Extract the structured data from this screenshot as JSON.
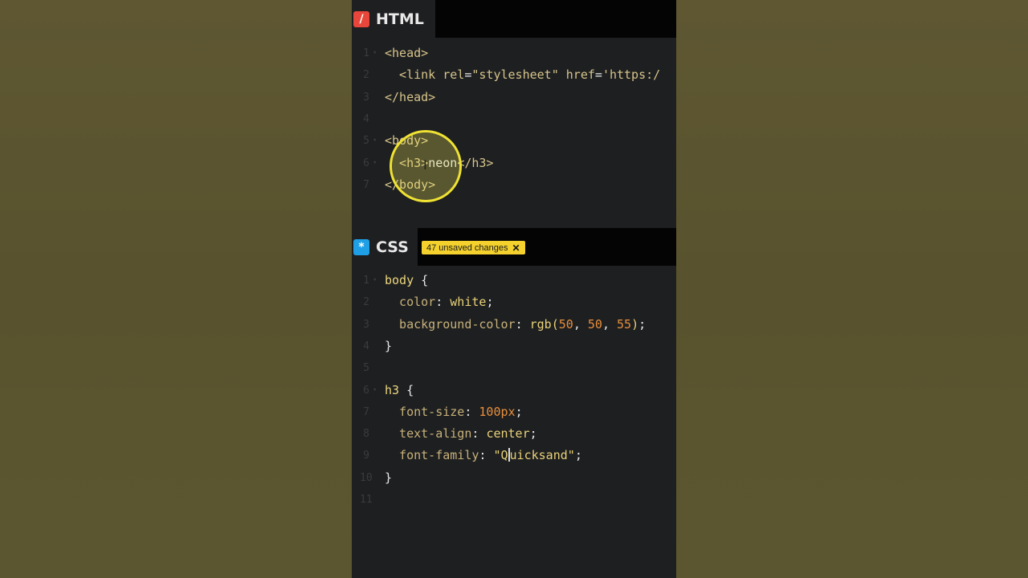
{
  "html_panel": {
    "tab_label": "HTML",
    "icon": "html-slash-icon",
    "lines": [
      {
        "n": "1",
        "fold": true,
        "segs": [
          [
            "tag",
            "<head>"
          ]
        ]
      },
      {
        "n": "2",
        "fold": false,
        "segs": [
          [
            "tag",
            "  <link "
          ],
          [
            "attr",
            "rel"
          ],
          [
            "plain",
            "="
          ],
          [
            "str",
            "\"stylesheet\""
          ],
          [
            "plain",
            " "
          ],
          [
            "attr",
            "href"
          ],
          [
            "plain",
            "="
          ],
          [
            "str",
            "'https:/"
          ]
        ]
      },
      {
        "n": "3",
        "fold": false,
        "segs": [
          [
            "tag",
            "</head>"
          ]
        ]
      },
      {
        "n": "4",
        "fold": false,
        "segs": []
      },
      {
        "n": "5",
        "fold": true,
        "segs": [
          [
            "tag",
            "<body>"
          ]
        ]
      },
      {
        "n": "6",
        "fold": true,
        "segs": [
          [
            "tag",
            "  <h3>"
          ],
          [
            "plain",
            "neon"
          ],
          [
            "tag",
            "</h3>"
          ]
        ]
      },
      {
        "n": "7",
        "fold": false,
        "segs": [
          [
            "tag",
            "</body>"
          ]
        ]
      }
    ]
  },
  "css_panel": {
    "tab_label": "CSS",
    "icon": "css-asterisk-icon",
    "unsaved_badge": "47 unsaved changes",
    "lines": [
      {
        "n": "1",
        "fold": true,
        "segs": [
          [
            "sel",
            "body"
          ],
          [
            "plain",
            " {"
          ]
        ]
      },
      {
        "n": "2",
        "fold": false,
        "segs": [
          [
            "prop",
            "  color"
          ],
          [
            "plain",
            ": "
          ],
          [
            "val",
            "white"
          ],
          [
            "plain",
            ";"
          ]
        ]
      },
      {
        "n": "3",
        "fold": false,
        "segs": [
          [
            "prop",
            "  background-color"
          ],
          [
            "plain",
            ": "
          ],
          [
            "val",
            "rgb("
          ],
          [
            "num",
            "50"
          ],
          [
            "plain",
            ", "
          ],
          [
            "num",
            "50"
          ],
          [
            "plain",
            ", "
          ],
          [
            "num",
            "55"
          ],
          [
            "val",
            ")"
          ],
          [
            "plain",
            ";"
          ]
        ]
      },
      {
        "n": "4",
        "fold": false,
        "segs": [
          [
            "plain",
            "}"
          ]
        ]
      },
      {
        "n": "5",
        "fold": false,
        "segs": []
      },
      {
        "n": "6",
        "fold": true,
        "segs": [
          [
            "sel",
            "h3"
          ],
          [
            "plain",
            " {"
          ]
        ]
      },
      {
        "n": "7",
        "fold": false,
        "segs": [
          [
            "prop",
            "  font-size"
          ],
          [
            "plain",
            ": "
          ],
          [
            "num",
            "100px"
          ],
          [
            "plain",
            ";"
          ]
        ]
      },
      {
        "n": "8",
        "fold": false,
        "segs": [
          [
            "prop",
            "  text-align"
          ],
          [
            "plain",
            ": "
          ],
          [
            "val",
            "center"
          ],
          [
            "plain",
            ";"
          ]
        ]
      },
      {
        "n": "9",
        "fold": false,
        "segs": [
          [
            "prop",
            "  font-family"
          ],
          [
            "plain",
            ": "
          ],
          [
            "val",
            "\"Q"
          ],
          [
            "cursor",
            ""
          ],
          [
            "val",
            "uicksand\""
          ],
          [
            "plain",
            ";"
          ]
        ]
      },
      {
        "n": "10",
        "fold": false,
        "segs": [
          [
            "plain",
            "}"
          ]
        ]
      },
      {
        "n": "11",
        "fold": false,
        "segs": []
      }
    ]
  },
  "colors": {
    "editor_bg": "#1e1f21",
    "html_icon": "#e8463a",
    "css_icon": "#1e9fe6",
    "badge": "#f4d12d",
    "highlight_ring": "#efe233"
  }
}
